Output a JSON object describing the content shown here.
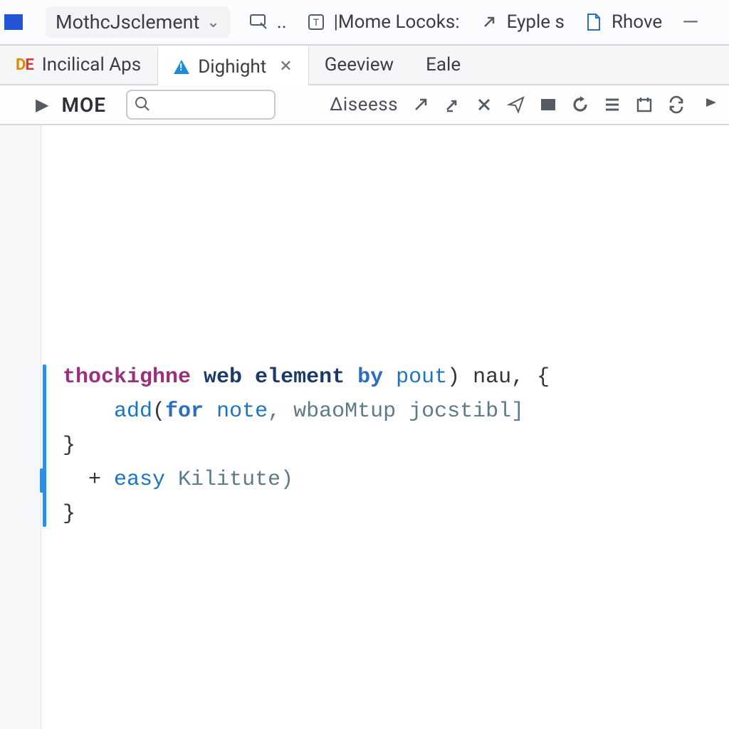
{
  "menubar": {
    "project_name": "MothcJsclement",
    "items": [
      {
        "icon": "inspect-icon",
        "label": ".."
      },
      {
        "icon": "text-panel-icon",
        "label": "|Mome Locoks:"
      },
      {
        "icon": "arrow-ne-icon",
        "label": "Eyple s"
      },
      {
        "icon": "file-icon",
        "label": "Rhove"
      }
    ]
  },
  "tabs": {
    "items": [
      {
        "badge": "DE",
        "label": "Incilical Aps",
        "active": false,
        "closable": false
      },
      {
        "badge": "warn",
        "label": "Dighight",
        "active": true,
        "closable": true
      },
      {
        "label": "Geeview",
        "active": false
      },
      {
        "label": "Eale",
        "active": false
      }
    ]
  },
  "toolbar": {
    "run_label": "MOE",
    "search_placeholder": "",
    "aisess_label": "Δiseess"
  },
  "code": {
    "line1_a": "thockighne",
    "line1_b": "web element",
    "line1_c": "by",
    "line1_d": "pout",
    "line1_e": ") nau, {",
    "line2_a": "add",
    "line2_b": "(",
    "line2_c": "for",
    "line2_d": "note",
    "line2_e": ", wbaoMtup jocstibl]",
    "line3": "}",
    "line4_a": "+ ",
    "line4_b": "easy",
    "line4_c": " Kilitute)",
    "line5": "}"
  }
}
